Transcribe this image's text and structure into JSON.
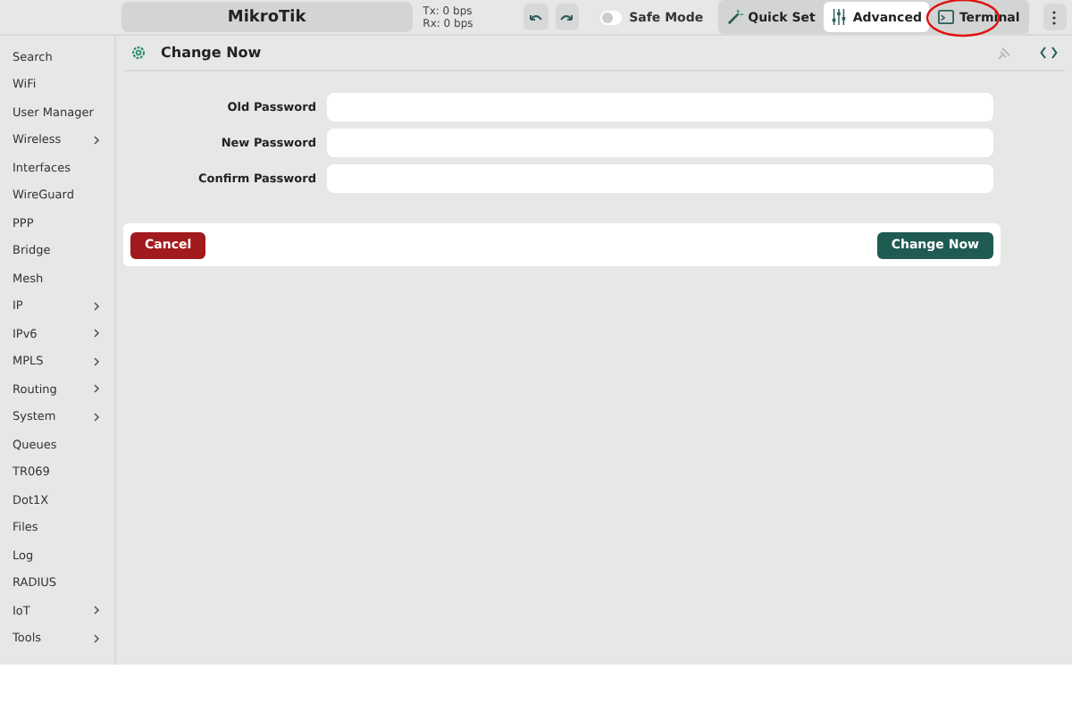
{
  "top_bar": {
    "title": "MikroTik",
    "tx": "Tx: 0 bps",
    "rx": "Rx: 0 bps",
    "safe_mode": {
      "label": "Safe Mode",
      "on": false
    },
    "modes": [
      {
        "label": "Quick Set",
        "selected": false,
        "kind": "wand"
      },
      {
        "label": "Advanced",
        "selected": true,
        "kind": "sliders"
      },
      {
        "label": "Terminal",
        "selected": false,
        "kind": "terminal",
        "circled": true
      }
    ]
  },
  "sidebar": {
    "items": [
      {
        "label": "Search",
        "submenu": false
      },
      {
        "label": "WiFi",
        "submenu": false
      },
      {
        "label": "User Manager",
        "submenu": false
      },
      {
        "label": "Wireless",
        "submenu": true
      },
      {
        "label": "Interfaces",
        "submenu": false
      },
      {
        "label": "WireGuard",
        "submenu": false
      },
      {
        "label": "PPP",
        "submenu": false
      },
      {
        "label": "Bridge",
        "submenu": false
      },
      {
        "label": "Mesh",
        "submenu": false
      },
      {
        "label": "IP",
        "submenu": true
      },
      {
        "label": "IPv6",
        "submenu": true
      },
      {
        "label": "MPLS",
        "submenu": true
      },
      {
        "label": "Routing",
        "submenu": true
      },
      {
        "label": "System",
        "submenu": true
      },
      {
        "label": "Queues",
        "submenu": false
      },
      {
        "label": "TR069",
        "submenu": false
      },
      {
        "label": "Dot1X",
        "submenu": false
      },
      {
        "label": "Files",
        "submenu": false
      },
      {
        "label": "Log",
        "submenu": false
      },
      {
        "label": "RADIUS",
        "submenu": false
      },
      {
        "label": "IoT",
        "submenu": true
      },
      {
        "label": "Tools",
        "submenu": true
      }
    ]
  },
  "panel": {
    "title": "Change Now",
    "fields": [
      {
        "label": "Old Password"
      },
      {
        "label": "New Password"
      },
      {
        "label": "Confirm Password"
      }
    ],
    "buttons": [
      {
        "label": "Cancel",
        "kind": "danger"
      },
      {
        "label": "Change Now",
        "kind": "primary"
      }
    ]
  }
}
